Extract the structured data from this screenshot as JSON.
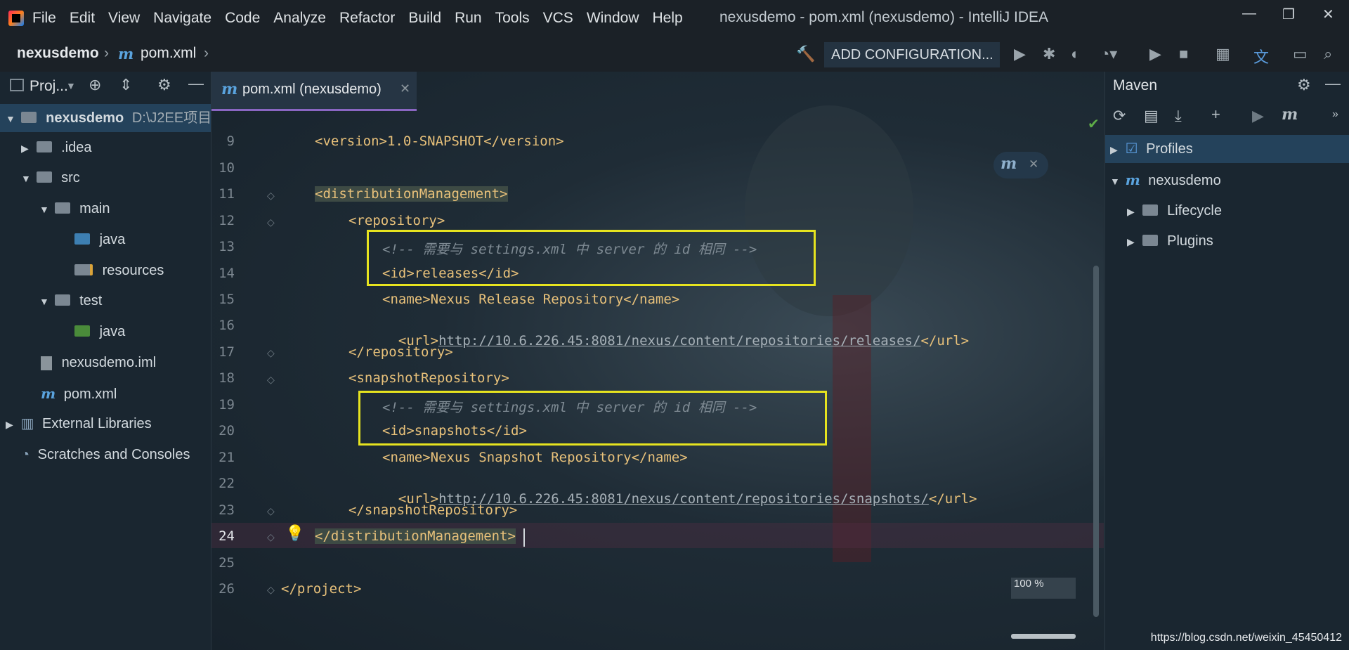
{
  "window": {
    "title": "nexusdemo - pom.xml (nexusdemo) - IntelliJ IDEA",
    "menu": [
      "File",
      "Edit",
      "View",
      "Navigate",
      "Code",
      "Analyze",
      "Refactor",
      "Build",
      "Run",
      "Tools",
      "VCS",
      "Window",
      "Help"
    ]
  },
  "breadcrumb": {
    "project": "nexusdemo",
    "file": "pom.xml"
  },
  "toolbar": {
    "add_config": "ADD CONFIGURATION..."
  },
  "project_panel": {
    "title": "Proj...",
    "root": {
      "name": "nexusdemo",
      "path": "D:\\J2EE项目"
    },
    "items": [
      ".idea",
      "src",
      "main",
      "java",
      "resources",
      "test",
      "java",
      "nexusdemo.iml",
      "pom.xml",
      "External Libraries",
      "Scratches and Consoles"
    ]
  },
  "editor": {
    "tab": "pom.xml (nexusdemo)",
    "zoom": "100 %",
    "lines": [
      {
        "n": "9",
        "text": "<version>1.0-SNAPSHOT</version>"
      },
      {
        "n": "10",
        "text": ""
      },
      {
        "n": "11",
        "text": "<distributionManagement>"
      },
      {
        "n": "12",
        "text": "<repository>"
      },
      {
        "n": "13",
        "text": "<!-- 需要与 settings.xml 中 server 的 id 相同 -->"
      },
      {
        "n": "14",
        "text": "<id>releases</id>"
      },
      {
        "n": "15",
        "text": "<name>Nexus Release Repository</name>"
      },
      {
        "n": "16",
        "open": "<url>",
        "url": "http://10.6.226.45:8081/nexus/content/repositories/releases/",
        "close": "</url>"
      },
      {
        "n": "17",
        "text": "</repository>"
      },
      {
        "n": "18",
        "text": "<snapshotRepository>"
      },
      {
        "n": "19",
        "text": "<!-- 需要与 settings.xml 中 server 的 id 相同 -->"
      },
      {
        "n": "20",
        "text": "<id>snapshots</id>"
      },
      {
        "n": "21",
        "text": "<name>Nexus Snapshot Repository</name>"
      },
      {
        "n": "22",
        "open": "<url>",
        "url": "http://10.6.226.45:8081/nexus/content/repositories/snapshots/",
        "close": "</url>"
      },
      {
        "n": "23",
        "text": "</snapshotRepository>"
      },
      {
        "n": "24",
        "text": "</distributionManagement>"
      },
      {
        "n": "25",
        "text": ""
      },
      {
        "n": "26",
        "text": "</project>"
      }
    ]
  },
  "maven": {
    "title": "Maven",
    "tree": [
      "Profiles",
      "nexusdemo",
      "Lifecycle",
      "Plugins"
    ]
  },
  "watermark": "https://blog.csdn.net/weixin_45450412",
  "colors": {
    "highlight_box": "#e6e31f",
    "tab_underline": "#8a66c2",
    "tag": "#e8c17a"
  }
}
